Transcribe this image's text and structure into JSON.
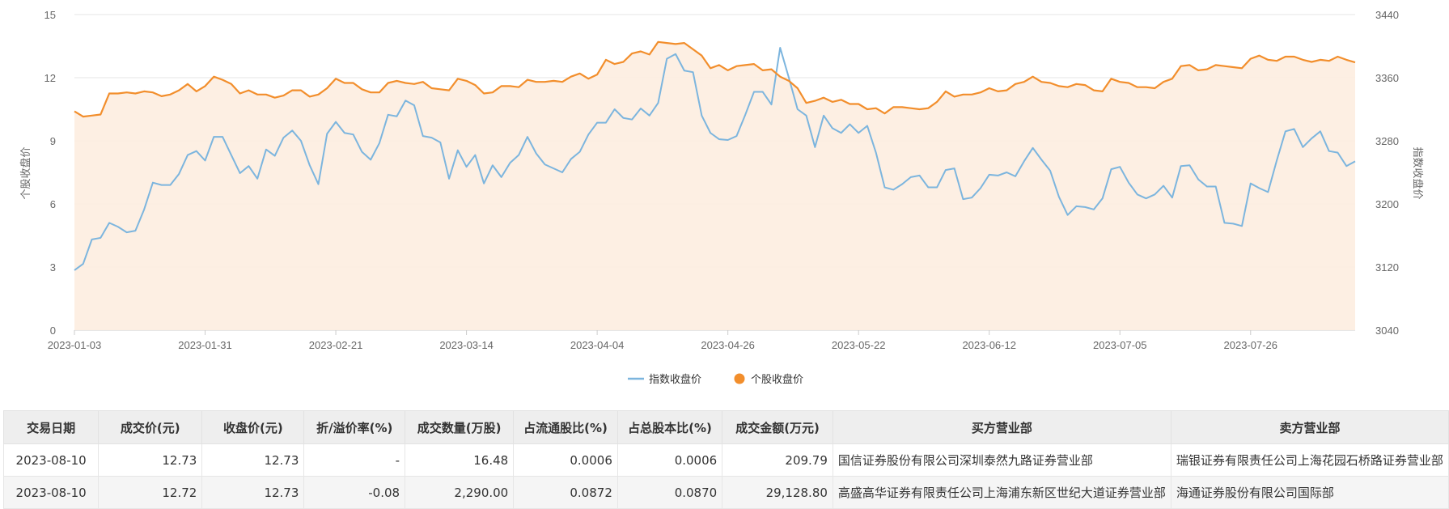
{
  "chart_data": {
    "type": "line",
    "title": "",
    "ylabel_left": "个股收盘价",
    "ylabel_right": "指数收盘价",
    "y_left_range": [
      0,
      15
    ],
    "y_left_ticks": [
      0,
      3,
      6,
      9,
      12,
      15
    ],
    "y_right_range": [
      3040,
      3440
    ],
    "y_right_ticks": [
      3040,
      3120,
      3200,
      3280,
      3360,
      3440
    ],
    "x_tick_labels": [
      "2023-01-03",
      "2023-01-31",
      "2023-02-21",
      "2023-03-14",
      "2023-04-04",
      "2023-04-26",
      "2023-05-22",
      "2023-06-12",
      "2023-07-05",
      "2023-07-26"
    ],
    "grid": true,
    "legend_position": "bottom",
    "series": [
      {
        "name": "指数收盘价",
        "axis": "right",
        "color": "#7cb5de",
        "values": [
          3116,
          3124,
          3155,
          3157,
          3176,
          3171,
          3164,
          3166,
          3193,
          3227,
          3224,
          3224,
          3238,
          3262,
          3267,
          3255,
          3285,
          3285,
          3262,
          3239,
          3248,
          3232,
          3269,
          3261,
          3284,
          3293,
          3280,
          3249,
          3225,
          3289,
          3304,
          3290,
          3288,
          3266,
          3256,
          3277,
          3313,
          3311,
          3331,
          3325,
          3286,
          3284,
          3278,
          3232,
          3268,
          3247,
          3262,
          3226,
          3249,
          3234,
          3252,
          3262,
          3285,
          3264,
          3250,
          3245,
          3240,
          3257,
          3266,
          3288,
          3303,
          3303,
          3320,
          3309,
          3307,
          3321,
          3312,
          3328,
          3384,
          3390,
          3369,
          3367,
          3312,
          3290,
          3282,
          3281,
          3286,
          3313,
          3342,
          3342,
          3326,
          3398,
          3360,
          3320,
          3312,
          3272,
          3312,
          3296,
          3290,
          3301,
          3290,
          3299,
          3265,
          3221,
          3218,
          3225,
          3234,
          3236,
          3221,
          3221,
          3243,
          3245,
          3206,
          3208,
          3220,
          3237,
          3236,
          3240,
          3235,
          3254,
          3271,
          3256,
          3242,
          3209,
          3186,
          3197,
          3196,
          3193,
          3207,
          3244,
          3247,
          3227,
          3212,
          3207,
          3212,
          3223,
          3208,
          3248,
          3249,
          3231,
          3222,
          3222,
          3176,
          3175,
          3172,
          3226,
          3220,
          3215,
          3255,
          3292,
          3295,
          3272,
          3283,
          3292,
          3267,
          3265,
          3248,
          3254
        ]
      },
      {
        "name": "个股收盘价",
        "axis": "left",
        "color": "#f28e2c",
        "values": [
          10.4,
          10.15,
          10.2,
          10.25,
          11.25,
          11.25,
          11.3,
          11.25,
          11.35,
          11.3,
          11.12,
          11.2,
          11.4,
          11.7,
          11.35,
          11.6,
          12.05,
          11.9,
          11.7,
          11.25,
          11.4,
          11.2,
          11.2,
          11.05,
          11.15,
          11.4,
          11.4,
          11.1,
          11.2,
          11.5,
          11.95,
          11.75,
          11.75,
          11.45,
          11.3,
          11.3,
          11.75,
          11.85,
          11.75,
          11.7,
          11.8,
          11.5,
          11.45,
          11.4,
          11.95,
          11.85,
          11.65,
          11.25,
          11.3,
          11.6,
          11.6,
          11.55,
          11.9,
          11.8,
          11.8,
          11.85,
          11.8,
          12.05,
          12.2,
          11.95,
          12.15,
          12.85,
          12.65,
          12.75,
          13.15,
          13.25,
          13.1,
          13.7,
          13.65,
          13.6,
          13.65,
          13.35,
          13.05,
          12.45,
          12.6,
          12.35,
          12.55,
          12.6,
          12.65,
          12.35,
          12.4,
          12.05,
          11.85,
          11.5,
          10.8,
          10.9,
          11.05,
          10.85,
          10.95,
          10.75,
          10.75,
          10.5,
          10.55,
          10.3,
          10.6,
          10.6,
          10.55,
          10.5,
          10.55,
          10.85,
          11.35,
          11.1,
          11.2,
          11.2,
          11.3,
          11.5,
          11.35,
          11.4,
          11.7,
          11.8,
          12.05,
          11.8,
          11.75,
          11.6,
          11.55,
          11.7,
          11.65,
          11.4,
          11.35,
          11.95,
          11.8,
          11.75,
          11.55,
          11.55,
          11.5,
          11.8,
          11.95,
          12.55,
          12.6,
          12.35,
          12.4,
          12.6,
          12.55,
          12.5,
          12.45,
          12.9,
          13.05,
          12.85,
          12.8,
          13.0,
          13.0,
          12.85,
          12.75,
          12.85,
          12.8,
          13.0,
          12.85,
          12.73
        ]
      }
    ]
  },
  "table": {
    "headers": [
      "交易日期",
      "成交价(元)",
      "收盘价(元)",
      "折/溢价率(%)",
      "成交数量(万股)",
      "占流通股比(%)",
      "占总股本比(%)",
      "成交金额(万元)",
      "买方营业部",
      "卖方营业部"
    ],
    "rows": [
      [
        "2023-08-10",
        "12.73",
        "12.73",
        "-",
        "16.48",
        "0.0006",
        "0.0006",
        "209.79",
        "国信证券股份有限公司深圳泰然九路证券营业部",
        "瑞银证券有限责任公司上海花园石桥路证券营业部"
      ],
      [
        "2023-08-10",
        "12.72",
        "12.73",
        "-0.08",
        "2,290.00",
        "0.0872",
        "0.0870",
        "29,128.80",
        "高盛高华证券有限责任公司上海浦东新区世纪大道证券营业部",
        "海通证券股份有限公司国际部"
      ]
    ]
  }
}
